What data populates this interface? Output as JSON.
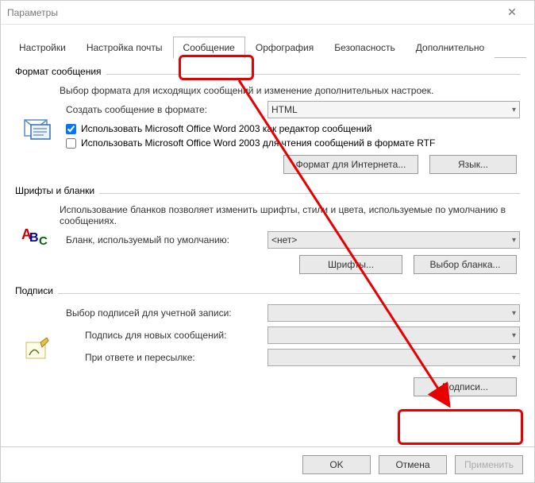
{
  "window": {
    "title": "Параметры"
  },
  "tabs": {
    "items": [
      {
        "label": "Настройки"
      },
      {
        "label": "Настройка почты"
      },
      {
        "label": "Сообщение"
      },
      {
        "label": "Орфография"
      },
      {
        "label": "Безопасность"
      },
      {
        "label": "Дополнительно"
      }
    ],
    "activeIndex": 2
  },
  "format": {
    "group_label": "Формат сообщения",
    "desc": "Выбор формата для исходящих сообщений и изменение дополнительных настроек.",
    "create_label": "Создать сообщение в формате:",
    "create_value": "HTML",
    "cb1": {
      "label": "Использовать Microsoft Office Word 2003 как редактор сообщений",
      "checked": true
    },
    "cb2": {
      "label": "Использовать Microsoft Office Word 2003 для чтения сообщений в формате RTF",
      "checked": false
    },
    "btn_internet": "Формат для Интернета...",
    "btn_lang": "Язык..."
  },
  "fonts": {
    "group_label": "Шрифты и бланки",
    "desc": "Использование бланков позволяет изменить шрифты, стили и цвета, используемые по умолчанию в сообщениях.",
    "blank_label": "Бланк, используемый по умолчанию:",
    "blank_value": "<нет>",
    "btn_fonts": "Шрифты...",
    "btn_blank": "Выбор бланка..."
  },
  "signatures": {
    "group_label": "Подписи",
    "account_label": "Выбор подписей для учетной записи:",
    "new_label": "Подпись для новых сообщений:",
    "reply_label": "При ответе и пересылке:",
    "btn_sign": "Подписи..."
  },
  "footer": {
    "ok": "OK",
    "cancel": "Отмена",
    "apply": "Применить"
  }
}
